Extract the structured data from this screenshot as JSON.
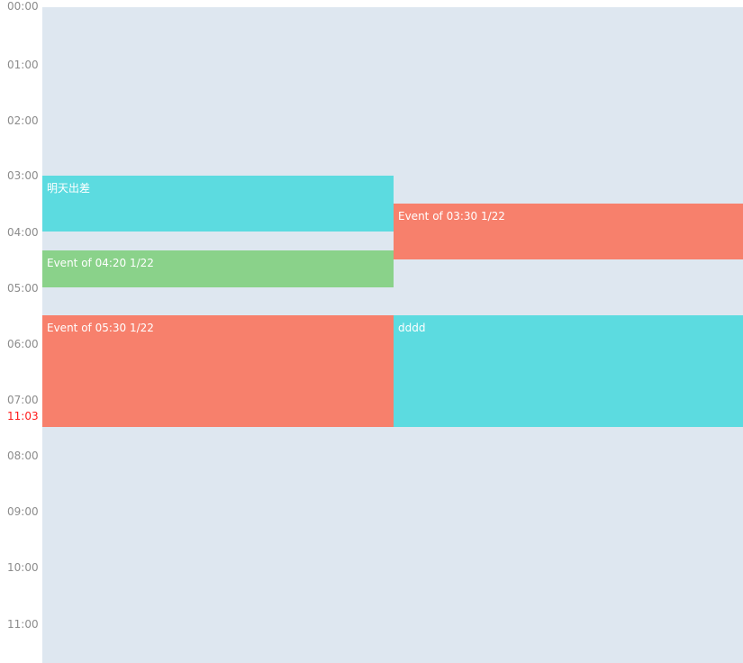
{
  "timeline": {
    "hours": [
      "00:00",
      "01:00",
      "02:00",
      "03:00",
      "04:00",
      "05:00",
      "06:00",
      "07:00",
      "08:00",
      "09:00",
      "10:00",
      "11:00"
    ],
    "current_time": "11:03",
    "current_time_color": "#ff1a1a",
    "background_color": "#dee7f0"
  },
  "events": [
    {
      "title": "明天出差",
      "color": "#5cdbe0"
    },
    {
      "title": "Event of 03:30 1/22",
      "color": "#f7806c"
    },
    {
      "title": "Event of 04:20 1/22",
      "color": "#8ad28a"
    },
    {
      "title": "Event of 05:30 1/22",
      "color": "#f7806c"
    },
    {
      "title": "dddd",
      "color": "#5cdbe0"
    }
  ]
}
